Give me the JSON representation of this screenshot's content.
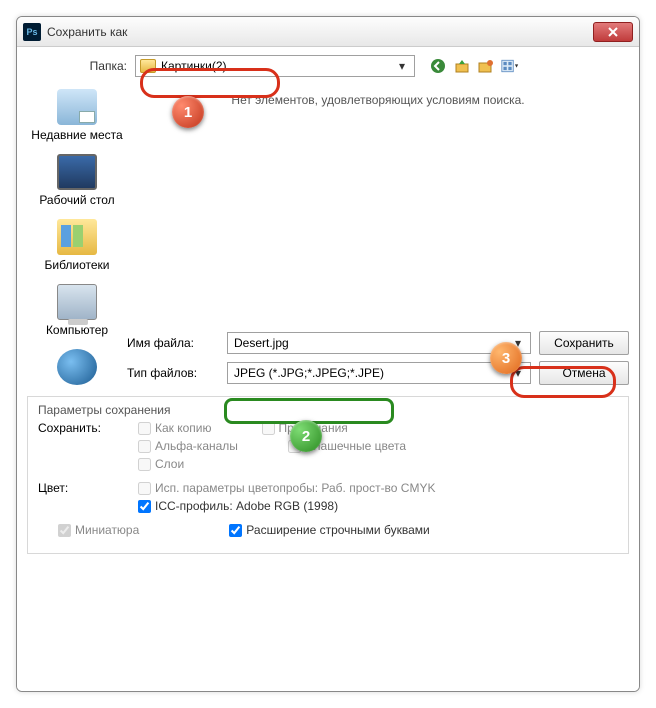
{
  "window": {
    "title": "Сохранить как"
  },
  "folder": {
    "label": "Папка:",
    "value": "Картинки(2)"
  },
  "filelist": {
    "empty": "Нет элементов, удовлетворяющих условиям поиска."
  },
  "places": {
    "recent": "Недавние места",
    "desktop": "Рабочий стол",
    "libraries": "Библиотеки",
    "computer": "Компьютер"
  },
  "filename": {
    "label": "Имя файла:",
    "value": "Desert.jpg"
  },
  "filetype": {
    "label": "Тип файлов:",
    "value": "JPEG (*.JPG;*.JPEG;*.JPE)"
  },
  "buttons": {
    "save": "Сохранить",
    "cancel": "Отмена"
  },
  "saveopts": {
    "title": "Параметры сохранения",
    "saveAs": "Сохранить:",
    "asCopy": "Как копию",
    "notes": "Примечания",
    "alpha": "Альфа-каналы",
    "spot": "Плашечные цвета",
    "layers": "Слои",
    "color": "Цвет:",
    "proof": "Исп. параметры цветопробы:  Раб. прост-во CMYK",
    "icc": "ICC-профиль:  Adobe RGB (1998)"
  },
  "bottom": {
    "thumb": "Миниатюра",
    "lowerext": "Расширение строчными буквами"
  },
  "callouts": {
    "c1": "1",
    "c2": "2",
    "c3": "3"
  }
}
